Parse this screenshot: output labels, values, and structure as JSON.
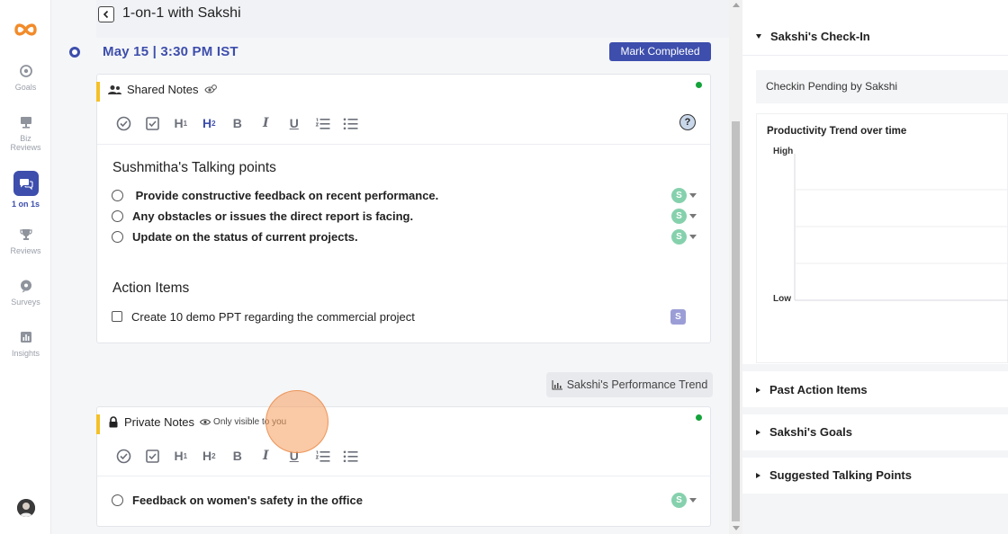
{
  "colors": {
    "accent": "#3d4eac",
    "note_marker": "#f5c027",
    "online": "#14a33a",
    "owner_avatar": "#86d1ad",
    "owner_square": "#9b9ed6"
  },
  "leftnav": {
    "items": [
      {
        "label": "Goals",
        "icon": "target-icon"
      },
      {
        "label_line1": "Biz",
        "label_line2": "Reviews",
        "icon": "presentation-icon"
      },
      {
        "label": "1 on 1s",
        "icon": "chat-bubbles-icon",
        "active": true
      },
      {
        "label": "Reviews",
        "icon": "trophy-icon"
      },
      {
        "label": "Surveys",
        "icon": "survey-icon"
      },
      {
        "label": "Insights",
        "icon": "bar-chart-icon"
      }
    ]
  },
  "header": {
    "title": "1-on-1 with Sakshi"
  },
  "meeting": {
    "date_time": "May 15 | 3:30 PM IST",
    "mark_completed": "Mark Completed"
  },
  "shared_notes": {
    "title": "Shared Notes",
    "talking_points_title": "Sushmitha's Talking points",
    "talking_points": [
      {
        "text": " Provide constructive feedback on recent performance.",
        "owner": "S"
      },
      {
        "text": "Any obstacles or issues the direct report is facing.",
        "owner": "S"
      },
      {
        "text": "Update on the status of current projects.",
        "owner": "S"
      }
    ],
    "action_items_title": "Action Items",
    "action_items": [
      {
        "text": "Create 10 demo PPT regarding the commercial project",
        "owner": "S"
      }
    ],
    "toolbar": {
      "h1": "H",
      "h1_sub": "1",
      "h2": "H",
      "h2_sub": "2",
      "bold": "B",
      "italic": "I",
      "underline": "U",
      "help": "?"
    }
  },
  "performance_trend_button": "Sakshi's Performance Trend",
  "private_notes": {
    "title": "Private Notes",
    "visibility": "Only visible to you",
    "items": [
      {
        "text": "Feedback on women's safety in the office",
        "owner": "S"
      }
    ]
  },
  "right_panel": {
    "checkin_title": "Sakshi's Check-In",
    "checkin_status": "Checkin Pending by Sakshi",
    "trend_chart": {
      "title": "Productivity Trend over time",
      "y_high": "High",
      "y_low": "Low"
    },
    "sections": [
      "Past Action Items",
      "Sakshi's Goals",
      "Suggested Talking Points"
    ]
  }
}
